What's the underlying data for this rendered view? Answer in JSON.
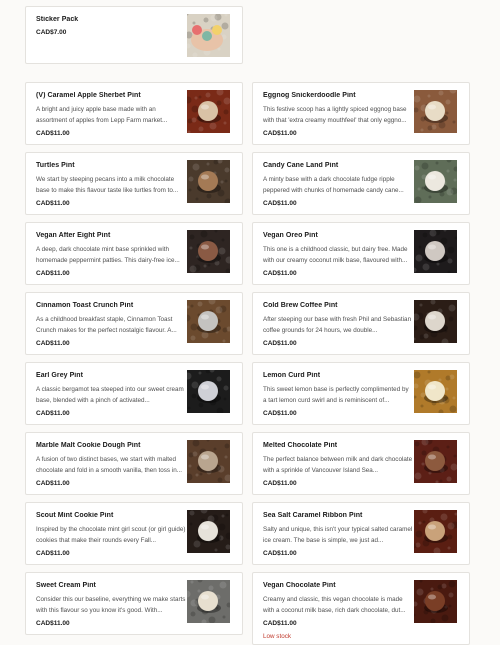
{
  "products": [
    {
      "name": "Sticker Pack",
      "desc": "",
      "price": "CAD$7.00",
      "stock": "",
      "image": "sticker-pack-photo",
      "bg": "#d9d2c4",
      "scoop": "#e9b8b0"
    },
    {
      "name": "(V) Caramel Apple Sherbet Pint",
      "desc": "A bright and juicy apple base made with an assortment of apples from Lepp Farm market...",
      "price": "CAD$11.00",
      "stock": "",
      "image": "ice-cream-scoop-photo",
      "bg": "#7a2a17",
      "scoop": "#d9c2a6"
    },
    {
      "name": "Eggnog Snickerdoodle Pint",
      "desc": "This festive scoop has a lightly spiced eggnog base with that 'extra creamy mouthfeel' that only eggno...",
      "price": "CAD$11.00",
      "stock": "",
      "image": "ice-cream-scoop-photo",
      "bg": "#8a5a3c",
      "scoop": "#e8dcc6"
    },
    {
      "name": "Turtles Pint",
      "desc": "We start by steeping pecans into a milk chocolate base to make this flavour taste like turtles from to...",
      "price": "CAD$11.00",
      "stock": "",
      "image": "ice-cream-scoop-photo",
      "bg": "#4a3a2c",
      "scoop": "#a47a55"
    },
    {
      "name": "Candy Cane Land Pint",
      "desc": "A minty base with a dark chocolate fudge ripple peppered with chunks of homemade candy cane...",
      "price": "CAD$11.00",
      "stock": "",
      "image": "ice-cream-scoop-photo",
      "bg": "#5f6d58",
      "scoop": "#ece8df"
    },
    {
      "name": "Vegan After Eight Pint",
      "desc": "A deep, dark chocolate mint base sprinkled with homemade peppermint patties. This dairy-free ice...",
      "price": "CAD$11.00",
      "stock": "",
      "image": "ice-cream-scoop-photo",
      "bg": "#2e2522",
      "scoop": "#8a5a44"
    },
    {
      "name": "Vegan Oreo Pint",
      "desc": "This one is a childhood classic, but dairy free. Made with our creamy coconut milk base, flavoured with...",
      "price": "CAD$11.00",
      "stock": "",
      "image": "ice-cream-scoop-photo",
      "bg": "#1e1b1c",
      "scoop": "#cfc8c2"
    },
    {
      "name": "Cinnamon Toast Crunch Pint",
      "desc": "As a childhood breakfast staple, Cinnamon Toast Crunch makes for the perfect nostalgic flavour. A...",
      "price": "CAD$11.00",
      "stock": "",
      "image": "ice-cream-scoop-photo",
      "bg": "#6b4a2e",
      "scoop": "#c4c3c0"
    },
    {
      "name": "Cold Brew Coffee Pint",
      "desc": "After steeping our base with fresh Phil and Sebastian coffee grounds for 24 hours, we double...",
      "price": "CAD$11.00",
      "stock": "",
      "image": "ice-cream-scoop-photo",
      "bg": "#2b1d16",
      "scoop": "#ddd6cc"
    },
    {
      "name": "Earl Grey Pint",
      "desc": "A classic bergamot tea steeped into our sweet cream base, blended with a pinch of activated...",
      "price": "CAD$11.00",
      "stock": "",
      "image": "ice-cream-scoop-photo",
      "bg": "#1c1c1c",
      "scoop": "#cfd0d6"
    },
    {
      "name": "Lemon Curd Pint",
      "desc": "This sweet lemon base is perfectly complimented by a tart lemon curd swirl and is reminiscent of...",
      "price": "CAD$11.00",
      "stock": "",
      "image": "ice-cream-scoop-photo",
      "bg": "#b07a2a",
      "scoop": "#f0e6c9"
    },
    {
      "name": "Marble Malt Cookie Dough Pint",
      "desc": "A fusion of two distinct bases, we start with malted chocolate and fold in a smooth vanilla, then toss in...",
      "price": "CAD$11.00",
      "stock": "",
      "image": "ice-cream-scoop-photo",
      "bg": "#5a3e2b",
      "scoop": "#b9a58f"
    },
    {
      "name": "Melted Chocolate Pint",
      "desc": "The perfect balance between milk and dark chocolate with a sprinkle of Vancouver Island Sea...",
      "price": "CAD$11.00",
      "stock": "",
      "image": "ice-cream-scoop-photo",
      "bg": "#5c1f16",
      "scoop": "#8d5a3e"
    },
    {
      "name": "Scout Mint Cookie Pint",
      "desc": "Inspired by the chocolate mint girl scout (or girl guide) cookies that make their rounds every Fall...",
      "price": "CAD$11.00",
      "stock": "",
      "image": "ice-cream-scoop-photo",
      "bg": "#251c18",
      "scoop": "#e6e2da"
    },
    {
      "name": "Sea Salt Caramel Ribbon Pint",
      "desc": "Salty and unique, this isn't your typical salted caramel ice cream. The base is simple, we just ad...",
      "price": "CAD$11.00",
      "stock": "",
      "image": "ice-cream-scoop-photo",
      "bg": "#5a1e12",
      "scoop": "#c9a27a"
    },
    {
      "name": "Sweet Cream Pint",
      "desc": "Consider this our baseline, everything we make starts with this flavour so you know it's good. With...",
      "price": "CAD$11.00",
      "stock": "",
      "image": "ice-cream-scoop-photo",
      "bg": "#6d6d6a",
      "scoop": "#e7dfcf"
    },
    {
      "name": "Vegan Chocolate Pint",
      "desc": "Creamy and classic, this vegan chocolate is made with a coconut milk base, rich dark chocolate, dut...",
      "price": "CAD$11.00",
      "stock": "Low stock",
      "image": "ice-cream-scoop-photo",
      "bg": "#4a1a10",
      "scoop": "#7a3e26"
    }
  ]
}
